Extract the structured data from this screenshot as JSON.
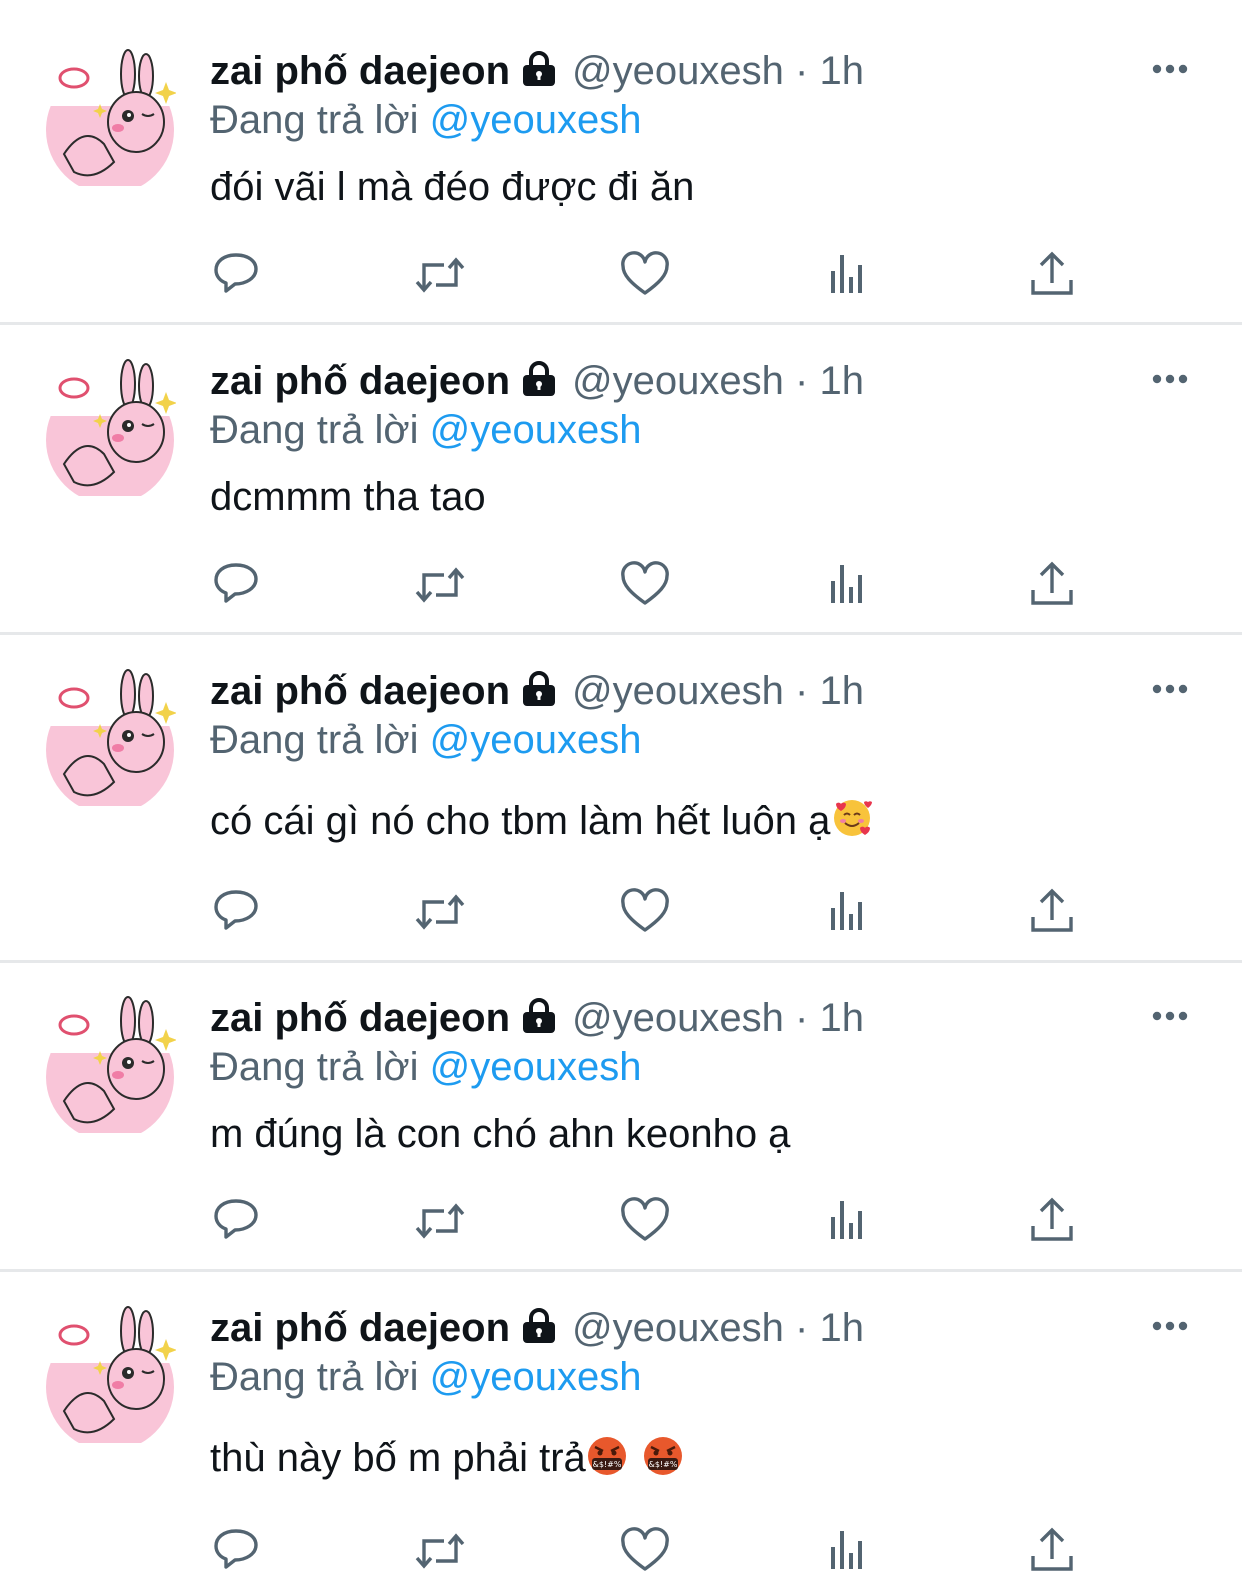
{
  "tweets": [
    {
      "display_name": "zai phố daejeon",
      "handle": "@yeouxesh",
      "dot": "·",
      "time": "1h",
      "reply_prefix": "Đang trả lời",
      "reply_to": "@yeouxesh",
      "text": "đói vãi l mà đéo được đi ăn"
    },
    {
      "display_name": "zai phố daejeon",
      "handle": "@yeouxesh",
      "dot": "·",
      "time": "1h",
      "reply_prefix": "Đang trả lời",
      "reply_to": "@yeouxesh",
      "text": "dcmmm tha tao"
    },
    {
      "display_name": "zai phố daejeon",
      "handle": "@yeouxesh",
      "dot": "·",
      "time": "1h",
      "reply_prefix": "Đang trả lời",
      "reply_to": "@yeouxesh",
      "text": "có cái gì nó cho tbm làm hết luôn ạ",
      "emoji": "smiling-face-with-hearts"
    },
    {
      "display_name": "zai phố daejeon",
      "handle": "@yeouxesh",
      "dot": "·",
      "time": "1h",
      "reply_prefix": "Đang trả lời",
      "reply_to": "@yeouxesh",
      "text": "m đúng là con chó ahn keonho ạ"
    },
    {
      "display_name": "zai phố daejeon",
      "handle": "@yeouxesh",
      "dot": "·",
      "time": "1h",
      "reply_prefix": "Đang trả lời",
      "reply_to": "@yeouxesh",
      "text": "thù này bố m phải trả",
      "emoji": "face-with-symbols-on-mouth",
      "emoji_text": "&$!#%"
    }
  ],
  "colors": {
    "primary_text": "#0f1419",
    "secondary_text": "#536471",
    "link": "#1d9bf0",
    "divider": "#e6e8ea",
    "icon": "#536471",
    "avatar_bg": "#f9c5d8"
  },
  "icons": [
    "lock-icon",
    "more-icon",
    "reply-icon",
    "retweet-icon",
    "like-icon",
    "analytics-icon",
    "share-icon"
  ]
}
